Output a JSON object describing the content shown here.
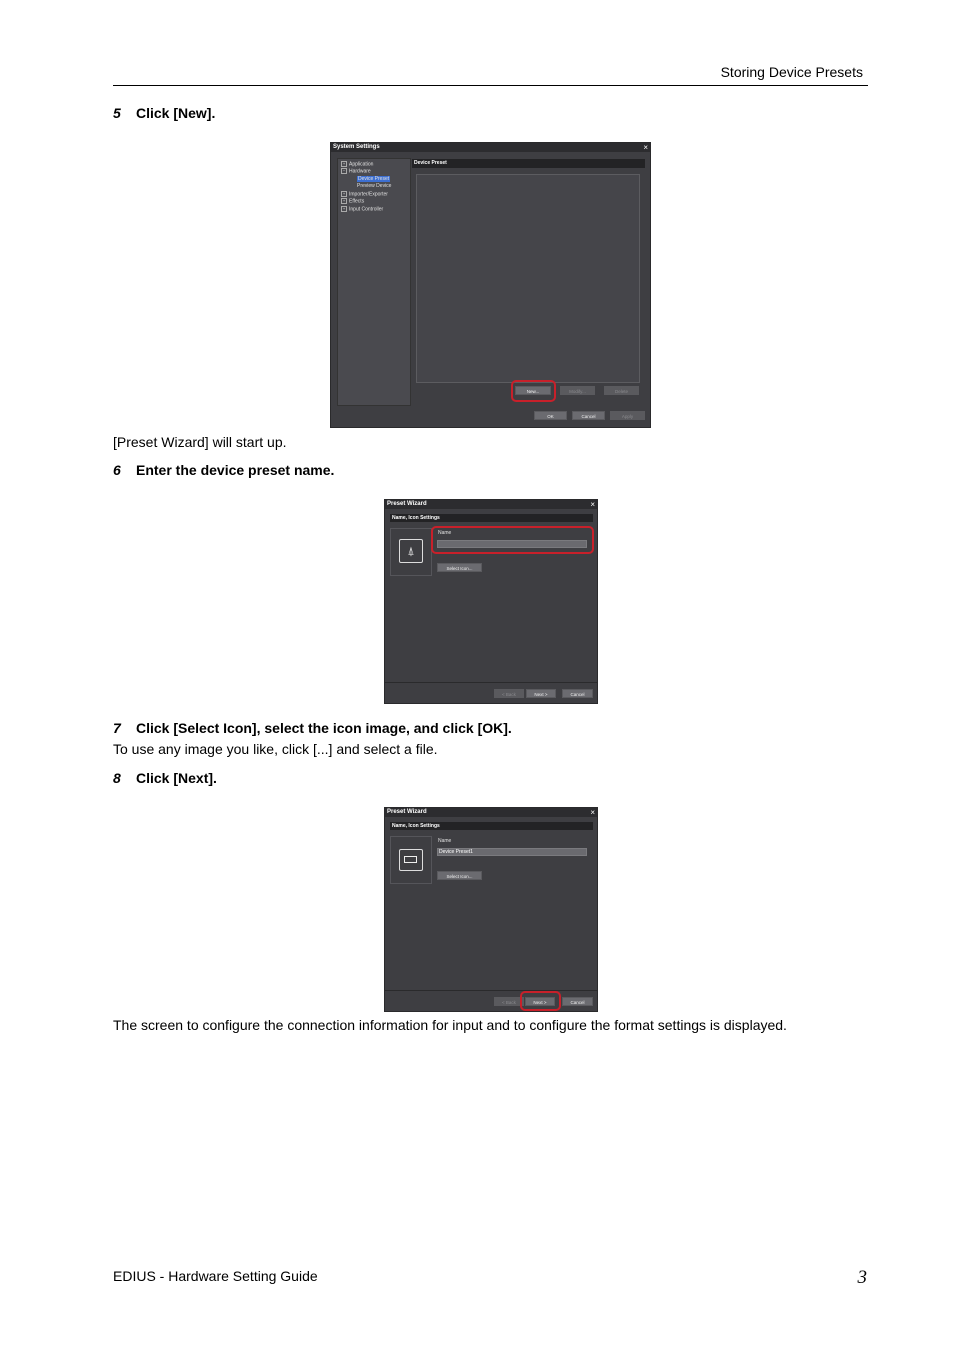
{
  "header": {
    "title": "Storing Device Presets"
  },
  "steps": [
    {
      "num": "5",
      "text": "Click [New]."
    },
    {
      "num": "6",
      "text": "Enter the device preset name."
    },
    {
      "num": "7",
      "text": "Click [Select Icon], select the icon image, and click [OK]."
    },
    {
      "num": "8",
      "text": "Click [Next]."
    }
  ],
  "paragraphs": {
    "after_step5": "[Preset Wizard] will start up.",
    "after_step7": "To use any image you like, click [...] and select a file.",
    "after_step8": "The screen to configure the connection information for input and to configure the format settings is displayed."
  },
  "dialog_system_settings": {
    "title": "System Settings",
    "close": "×",
    "tree": [
      "Application",
      "Hardware",
      "Device Preset",
      "Preview Device",
      "Importer/Exporter",
      "Effects",
      "Input Controller"
    ],
    "panel_title": "Device Preset",
    "buttons": {
      "new": "New...",
      "modify": "Modify...",
      "delete": "Delete",
      "ok": "OK",
      "cancel": "Cancel",
      "apply": "Apply"
    }
  },
  "dialog_wizard_1": {
    "title": "Preset Wizard",
    "close": "×",
    "section": "Name, Icon Settings",
    "name_label": "Name",
    "name_value": "",
    "select_icon": "Select Icon...",
    "back": "< Back",
    "next": "Next >",
    "cancel": "Cancel"
  },
  "dialog_wizard_2": {
    "title": "Preset Wizard",
    "close": "×",
    "section": "Name, Icon Settings",
    "name_label": "Name",
    "name_value": "Device Preset1",
    "select_icon": "Select Icon...",
    "back": "< Back",
    "next": "Next >",
    "cancel": "Cancel"
  },
  "footer": {
    "left": "EDIUS - Hardware Setting Guide",
    "page": "3"
  },
  "colors": {
    "dialog_bg": "#3e3e42",
    "highlight_ring": "#c8202a",
    "selection": "#3d6fd1"
  }
}
